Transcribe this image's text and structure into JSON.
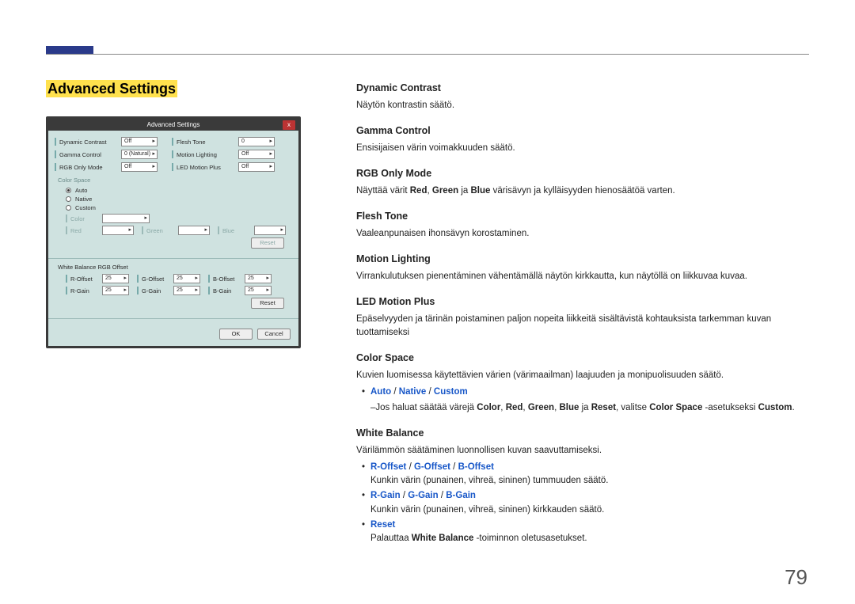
{
  "page_number": "79",
  "section_title": "Advanced Settings",
  "panel": {
    "title": "Advanced Settings",
    "close": "x",
    "rows": [
      {
        "l1": "Dynamic Contrast",
        "v1": "Off",
        "l2": "Flesh Tone",
        "v2": "0"
      },
      {
        "l1": "Gamma Control",
        "v1": "0 (Natural)",
        "l2": "Motion Lighting",
        "v2": "Off"
      },
      {
        "l1": "RGB Only Mode",
        "v1": "Off",
        "l2": "LED Motion Plus",
        "v2": "Off"
      }
    ],
    "color_space_label": "Color Space",
    "radios": [
      {
        "label": "Auto",
        "checked": true
      },
      {
        "label": "Native",
        "checked": false
      },
      {
        "label": "Custom",
        "checked": false
      }
    ],
    "custom_rows": [
      {
        "l": "Color",
        "v": ""
      },
      {
        "l1": "Red",
        "v1": "",
        "l2": "Green",
        "v2": "",
        "l3": "Blue",
        "v3": ""
      }
    ],
    "reset1": "Reset",
    "wb_label": "White Balance RGB Offset",
    "wb_rows": [
      {
        "l1": "R-Offset",
        "v1": "25",
        "l2": "G-Offset",
        "v2": "25",
        "l3": "B-Offset",
        "v3": "25"
      },
      {
        "l1": "R-Gain",
        "v1": "25",
        "l2": "G-Gain",
        "v2": "25",
        "l3": "B-Gain",
        "v3": "25"
      }
    ],
    "reset2": "Reset",
    "ok": "OK",
    "cancel": "Cancel"
  },
  "right": {
    "dc_h": "Dynamic Contrast",
    "dc_p": "Näytön kontrastin säätö.",
    "gc_h": "Gamma Control",
    "gc_p": "Ensisijaisen värin voimakkuuden säätö.",
    "rgb_h": "RGB Only Mode",
    "rgb_p1": "Näyttää värit ",
    "rgb_red": "Red",
    "rgb_sep1": ", ",
    "rgb_green": "Green",
    "rgb_sep2": " ja ",
    "rgb_blue": "Blue",
    "rgb_p2": " värisävyn ja kylläisyyden hienosäätöä varten.",
    "ft_h": "Flesh Tone",
    "ft_p": "Vaaleanpunaisen ihonsävyn korostaminen.",
    "ml_h": "Motion Lighting",
    "ml_p": "Virrankulutuksen pienentäminen vähentämällä näytön kirkkautta, kun näytöllä on liikkuvaa kuvaa.",
    "lmp_h": "LED Motion Plus",
    "lmp_p": "Epäselvyyden ja tärinän poistaminen paljon nopeita liikkeitä sisältävistä kohtauksista tarkemman kuvan tuottamiseksi",
    "cs_h": "Color Space",
    "cs_p": "Kuvien luomisessa käytettävien värien (värimaailman) laajuuden ja monipuolisuuden säätö.",
    "cs_opt_auto": "Auto",
    "cs_opt_native": "Native",
    "cs_opt_custom": "Custom",
    "cs_sep": " / ",
    "cs_sub_pre": "Jos haluat säätää värejä ",
    "cs_sub_color": "Color",
    "cs_sub_c1": ", ",
    "cs_sub_red": "Red",
    "cs_sub_c2": ", ",
    "cs_sub_green": "Green",
    "cs_sub_c3": ", ",
    "cs_sub_blue": "Blue",
    "cs_sub_c4": " ja ",
    "cs_sub_reset": "Reset",
    "cs_sub_mid": ", valitse ",
    "cs_sub_cspace": "Color Space",
    "cs_sub_mid2": " -asetukseksi ",
    "cs_sub_custom": "Custom",
    "cs_sub_end": ".",
    "wb_h": "White Balance",
    "wb_p": "Värilämmön säätäminen luonnollisen kuvan saavuttamiseksi.",
    "wb_b1_roffset": "R-Offset",
    "wb_b1_goffset": "G-Offset",
    "wb_b1_boffset": "B-Offset",
    "wb_b1_p": "Kunkin värin (punainen, vihreä, sininen) tummuuden säätö.",
    "wb_b2_rgain": "R-Gain",
    "wb_b2_ggain": "G-Gain",
    "wb_b2_bgain": "B-Gain",
    "wb_b2_p": "Kunkin värin (punainen, vihreä, sininen) kirkkauden säätö.",
    "wb_b3_reset": "Reset",
    "wb_b3_pre": "Palauttaa ",
    "wb_b3_wb": "White Balance",
    "wb_b3_post": " -toiminnon oletusasetukset."
  }
}
